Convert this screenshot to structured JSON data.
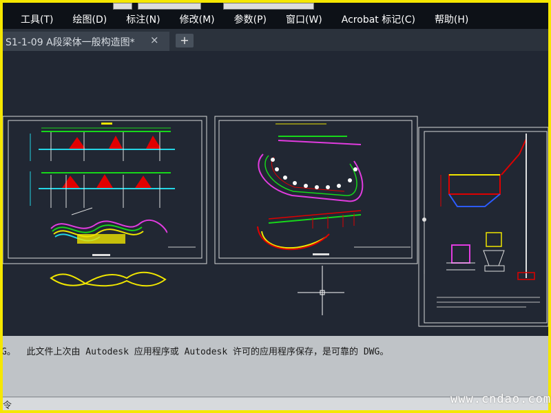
{
  "menubar": {
    "items": [
      "工具(T)",
      "绘图(D)",
      "标注(N)",
      "修改(M)",
      "参数(P)",
      "窗口(W)",
      "Acrobat 标记(C)",
      "帮助(H)"
    ]
  },
  "tabs": {
    "active_title": "S1-1-09 A段梁体一般构造图*",
    "close_glyph": "×",
    "new_tab_glyph": "+"
  },
  "command_line": {
    "message": "G。  此文件上次由 Autodesk 应用程序或 Autodesk 许可的应用程序保存，是可靠的 DWG。",
    "prompt_glyph": "令"
  },
  "watermark": "www.cndao.com",
  "colors": {
    "canvas_bg": "#212733",
    "frame_yellow": "#f5e700",
    "sheet_border": "#d8d8d8",
    "red": "#e00000",
    "green": "#17d81a",
    "yellow": "#f0e600",
    "magenta": "#e23ce0",
    "cyan": "#23d6e6",
    "blue": "#2c5bff"
  }
}
